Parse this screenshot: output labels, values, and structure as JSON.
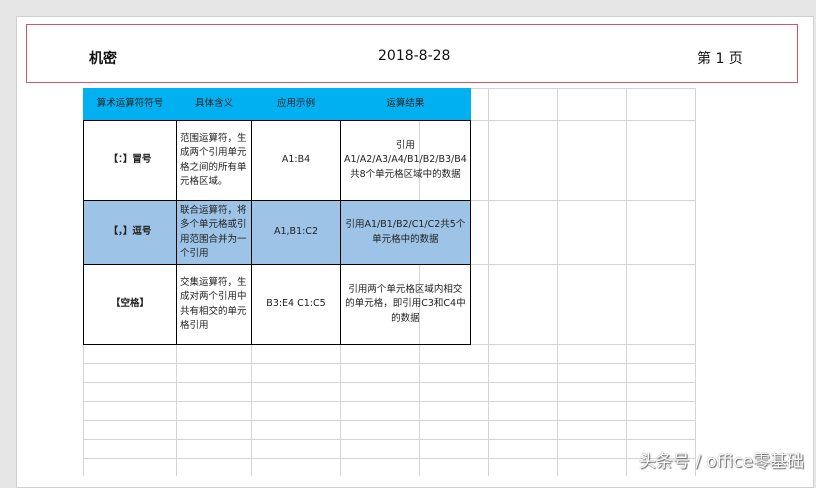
{
  "header": {
    "left": "机密",
    "center": "2018-8-28",
    "right": "第 1 页"
  },
  "table": {
    "columns": [
      "算术运算符符号",
      "具体含义",
      "应用示例",
      "运算结果"
    ],
    "rows": [
      {
        "symbol": "【：】冒号",
        "meaning": "范围运算符，生成两个引用单元格之间的所有单元格区域。",
        "example": "A1:B4",
        "result": "引用A1/A2/A3/A4/B1/B2/B3/B4共8个单元格区域中的数据"
      },
      {
        "symbol": "【，】逗号",
        "meaning": "联合运算符，将多个单元格或引用范围合并为一个引用",
        "example": "A1,B1:C2",
        "result": "引用A1/B1/B2/C1/C2共5个单元格中的数据"
      },
      {
        "symbol": "【空格】",
        "meaning": "交集运算符，生成对两个引用中共有相交的单元格引用",
        "example": "B3:E4 C1:C5",
        "result": "引用两个单元格区域内相交的单元格，即引用C3和C4中的数据"
      }
    ]
  },
  "watermark": "头条号 / office零基础",
  "colors": {
    "header_fill": "#00b0f0",
    "highlight_row": "#9dc3e6",
    "header_border": "#d9535f"
  }
}
